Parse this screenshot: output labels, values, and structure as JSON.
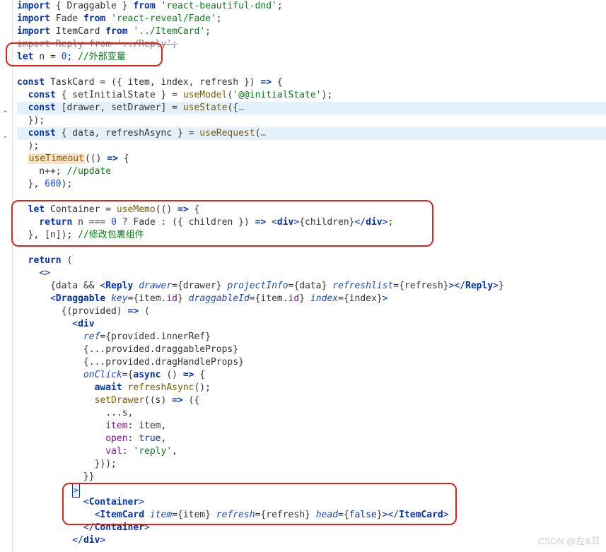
{
  "watermark": "CSDN @左&耳",
  "lines": [
    {
      "spans": [
        {
          "c": "kw",
          "t": "import"
        },
        {
          "t": " { Draggable } "
        },
        {
          "c": "kw",
          "t": "from"
        },
        {
          "t": " "
        },
        {
          "c": "str",
          "t": "'react-beautiful-dnd'"
        },
        {
          "t": ";"
        }
      ]
    },
    {
      "spans": [
        {
          "c": "kw",
          "t": "import"
        },
        {
          "t": " Fade "
        },
        {
          "c": "kw",
          "t": "from"
        },
        {
          "t": " "
        },
        {
          "c": "str",
          "t": "'react-reveal/Fade'"
        },
        {
          "t": ";"
        }
      ]
    },
    {
      "spans": [
        {
          "c": "kw",
          "t": "import"
        },
        {
          "t": " ItemCard "
        },
        {
          "c": "kw",
          "t": "from"
        },
        {
          "t": " "
        },
        {
          "c": "str",
          "t": "'../ItemCard'"
        },
        {
          "t": ";"
        }
      ]
    },
    {
      "spans": [
        {
          "c": "strike",
          "t": "import Reply from '../Reply';"
        }
      ]
    },
    {
      "spans": [
        {
          "c": "kw",
          "t": "let"
        },
        {
          "t": " n = "
        },
        {
          "c": "num",
          "t": "0"
        },
        {
          "t": "; "
        },
        {
          "c": "com-cn",
          "t": "//外部变量"
        }
      ]
    },
    {
      "spans": [
        {
          "t": ""
        }
      ]
    },
    {
      "spans": [
        {
          "c": "kw",
          "t": "const"
        },
        {
          "t": " "
        },
        {
          "c": "id",
          "t": "TaskCard"
        },
        {
          "t": " = ({ item, index, refresh }) "
        },
        {
          "c": "kw",
          "t": "=>"
        },
        {
          "t": " {"
        }
      ]
    },
    {
      "spans": [
        {
          "t": "  "
        },
        {
          "c": "kw",
          "t": "const"
        },
        {
          "t": " { setInitialState } = "
        },
        {
          "c": "fn",
          "t": "useModel"
        },
        {
          "t": "("
        },
        {
          "c": "str",
          "t": "'@@initialState'"
        },
        {
          "t": ");"
        }
      ]
    },
    {
      "cls": "hl-state",
      "spans": [
        {
          "t": "  "
        },
        {
          "c": "kw",
          "t": "const"
        },
        {
          "t": " [drawer, setDrawer] = "
        },
        {
          "c": "fn",
          "t": "useState"
        },
        {
          "t": "({"
        },
        {
          "c": "com",
          "t": "…"
        }
      ]
    },
    {
      "spans": [
        {
          "t": "  });"
        }
      ]
    },
    {
      "cls": "hl-req",
      "spans": [
        {
          "t": "  "
        },
        {
          "c": "kw",
          "t": "const"
        },
        {
          "t": " { data, refreshAsync } = "
        },
        {
          "c": "fn",
          "t": "useRequest"
        },
        {
          "t": "("
        },
        {
          "c": "com",
          "t": "…"
        }
      ]
    },
    {
      "spans": [
        {
          "t": "  );"
        }
      ]
    },
    {
      "spans": [
        {
          "t": "  "
        },
        {
          "c": "fn",
          "t": "useTimeout"
        },
        {
          "t": "(() "
        },
        {
          "c": "kw",
          "t": "=>"
        },
        {
          "t": " {"
        }
      ],
      "timeout": true
    },
    {
      "spans": [
        {
          "t": "    n++; "
        },
        {
          "c": "com-cn",
          "t": "//update"
        }
      ]
    },
    {
      "spans": [
        {
          "t": "  }, "
        },
        {
          "c": "num",
          "t": "600"
        },
        {
          "t": ");"
        }
      ]
    },
    {
      "spans": [
        {
          "t": ""
        }
      ]
    },
    {
      "spans": [
        {
          "t": "  "
        },
        {
          "c": "kw",
          "t": "let"
        },
        {
          "t": " Container = "
        },
        {
          "c": "fn",
          "t": "useMemo"
        },
        {
          "t": "(() "
        },
        {
          "c": "kw",
          "t": "=>"
        },
        {
          "t": " {"
        }
      ]
    },
    {
      "spans": [
        {
          "t": "    "
        },
        {
          "c": "kw",
          "t": "return"
        },
        {
          "t": " n === "
        },
        {
          "c": "num",
          "t": "0"
        },
        {
          "t": " ? Fade : ({ children }) "
        },
        {
          "c": "kw",
          "t": "=>"
        },
        {
          "t": " "
        },
        {
          "c": "jsx-br",
          "t": "<"
        },
        {
          "c": "tag",
          "t": "div"
        },
        {
          "c": "jsx-br",
          "t": ">"
        },
        {
          "t": "{children}"
        },
        {
          "c": "jsx-br",
          "t": "</"
        },
        {
          "c": "tag",
          "t": "div"
        },
        {
          "c": "jsx-br",
          "t": ">"
        },
        {
          "t": ";"
        }
      ]
    },
    {
      "spans": [
        {
          "t": "  }, [n]); "
        },
        {
          "c": "com-cn",
          "t": "//修改包裹组件"
        }
      ]
    },
    {
      "spans": [
        {
          "t": ""
        }
      ]
    },
    {
      "spans": [
        {
          "t": "  "
        },
        {
          "c": "kw",
          "t": "return"
        },
        {
          "t": " ("
        }
      ]
    },
    {
      "spans": [
        {
          "t": "    "
        },
        {
          "c": "jsx-br",
          "t": "<>"
        }
      ]
    },
    {
      "spans": [
        {
          "t": "      {data && "
        },
        {
          "c": "jsx-br",
          "t": "<"
        },
        {
          "c": "tag",
          "t": "Reply"
        },
        {
          "t": " "
        },
        {
          "c": "jsx-attr",
          "t": "drawer"
        },
        {
          "t": "={drawer} "
        },
        {
          "c": "jsx-attr",
          "t": "projectInfo"
        },
        {
          "t": "={data} "
        },
        {
          "c": "jsx-attr",
          "t": "refreshlist"
        },
        {
          "t": "={refresh}"
        },
        {
          "c": "jsx-br",
          "t": ">"
        },
        {
          "c": "jsx-br",
          "t": "</"
        },
        {
          "c": "tag",
          "t": "Reply"
        },
        {
          "c": "jsx-br",
          "t": ">"
        },
        {
          "t": "}"
        }
      ]
    },
    {
      "spans": [
        {
          "t": "      "
        },
        {
          "c": "jsx-br",
          "t": "<"
        },
        {
          "c": "tag",
          "t": "Draggable"
        },
        {
          "t": " "
        },
        {
          "c": "jsx-attr",
          "t": "key"
        },
        {
          "t": "={item."
        },
        {
          "c": "prop",
          "t": "id"
        },
        {
          "t": "} "
        },
        {
          "c": "jsx-attr",
          "t": "draggableId"
        },
        {
          "t": "={item."
        },
        {
          "c": "prop",
          "t": "id"
        },
        {
          "t": "} "
        },
        {
          "c": "jsx-attr",
          "t": "index"
        },
        {
          "t": "={index}"
        },
        {
          "c": "jsx-br",
          "t": ">"
        }
      ]
    },
    {
      "spans": [
        {
          "t": "        {(provided) "
        },
        {
          "c": "kw",
          "t": "=>"
        },
        {
          "t": " ("
        }
      ]
    },
    {
      "spans": [
        {
          "t": "          "
        },
        {
          "c": "jsx-br",
          "t": "<"
        },
        {
          "c": "tag",
          "t": "div"
        }
      ]
    },
    {
      "spans": [
        {
          "t": "            "
        },
        {
          "c": "jsx-attr",
          "t": "ref"
        },
        {
          "t": "={provided.innerRef}"
        }
      ]
    },
    {
      "spans": [
        {
          "t": "            {...provided.draggableProps}"
        }
      ]
    },
    {
      "spans": [
        {
          "t": "            {...provided.dragHandleProps}"
        }
      ]
    },
    {
      "spans": [
        {
          "t": "            "
        },
        {
          "c": "jsx-attr",
          "t": "onClick"
        },
        {
          "t": "={"
        },
        {
          "c": "kw",
          "t": "async"
        },
        {
          "t": " () "
        },
        {
          "c": "kw",
          "t": "=>"
        },
        {
          "t": " {"
        }
      ]
    },
    {
      "spans": [
        {
          "t": "              "
        },
        {
          "c": "kw",
          "t": "await"
        },
        {
          "t": " "
        },
        {
          "c": "fn",
          "t": "refreshAsync"
        },
        {
          "t": "();"
        }
      ]
    },
    {
      "spans": [
        {
          "t": "              "
        },
        {
          "c": "fn",
          "t": "setDrawer"
        },
        {
          "t": "((s) "
        },
        {
          "c": "kw",
          "t": "=>"
        },
        {
          "t": " ({"
        }
      ]
    },
    {
      "spans": [
        {
          "t": "                ...s,"
        }
      ]
    },
    {
      "spans": [
        {
          "t": "                "
        },
        {
          "c": "prop",
          "t": "item"
        },
        {
          "t": ": item,"
        }
      ]
    },
    {
      "spans": [
        {
          "t": "                "
        },
        {
          "c": "prop",
          "t": "open"
        },
        {
          "t": ": "
        },
        {
          "c": "boolv",
          "t": "true"
        },
        {
          "t": ","
        }
      ]
    },
    {
      "spans": [
        {
          "t": "                "
        },
        {
          "c": "prop",
          "t": "val"
        },
        {
          "t": ": "
        },
        {
          "c": "str",
          "t": "'reply'"
        },
        {
          "t": ","
        }
      ]
    },
    {
      "spans": [
        {
          "t": "              }));"
        }
      ]
    },
    {
      "spans": [
        {
          "t": "            }}"
        }
      ]
    },
    {
      "cursor": true,
      "spans": [
        {
          "t": "          "
        },
        {
          "c": "jsx-br",
          "t": ">"
        }
      ]
    },
    {
      "spans": [
        {
          "t": "            "
        },
        {
          "c": "jsx-br",
          "t": "<"
        },
        {
          "c": "tag",
          "t": "Container"
        },
        {
          "c": "jsx-br",
          "t": ">"
        }
      ]
    },
    {
      "spans": [
        {
          "t": "              "
        },
        {
          "c": "jsx-br",
          "t": "<"
        },
        {
          "c": "tag",
          "t": "ItemCard"
        },
        {
          "t": " "
        },
        {
          "c": "jsx-attr",
          "t": "item"
        },
        {
          "t": "={item} "
        },
        {
          "c": "jsx-attr",
          "t": "refresh"
        },
        {
          "t": "={refresh} "
        },
        {
          "c": "jsx-attr",
          "t": "head"
        },
        {
          "t": "={"
        },
        {
          "c": "boolv",
          "t": "false"
        },
        {
          "t": "}"
        },
        {
          "c": "jsx-br",
          "t": ">"
        },
        {
          "c": "jsx-br",
          "t": "</"
        },
        {
          "c": "tag",
          "t": "ItemCard"
        },
        {
          "c": "jsx-br",
          "t": ">"
        }
      ]
    },
    {
      "spans": [
        {
          "t": "            "
        },
        {
          "c": "jsx-br",
          "t": "</"
        },
        {
          "c": "tag",
          "t": "Container"
        },
        {
          "c": "jsx-br",
          "t": ">"
        }
      ]
    },
    {
      "spans": [
        {
          "t": "          "
        },
        {
          "c": "jsx-br",
          "t": "</"
        },
        {
          "c": "tag",
          "t": "div"
        },
        {
          "c": "jsx-br",
          "t": ">"
        }
      ]
    }
  ]
}
